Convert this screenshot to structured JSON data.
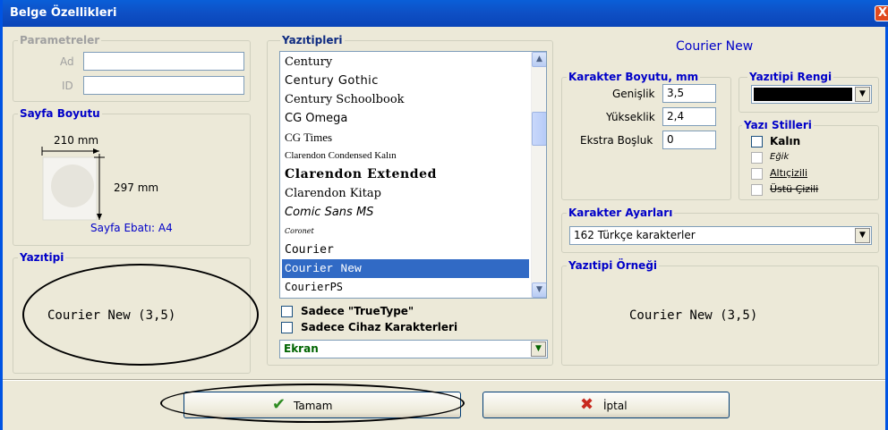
{
  "window": {
    "title": "Belge Özellikleri",
    "close_glyph": "X"
  },
  "parametreler": {
    "legend": "Parametreler",
    "ad_label": "Ad",
    "ad_value": "",
    "id_label": "ID",
    "id_value": ""
  },
  "sayfa_boyutu": {
    "legend": "Sayfa Boyutu",
    "width": "210 mm",
    "height": "297 mm",
    "ebat": "Sayfa Ebatı: A4"
  },
  "yazitipi_preview": {
    "legend": "Yazıtipi",
    "sample": "Courier New (3,5)"
  },
  "yazitipleri": {
    "legend": "Yazıtipleri",
    "items": [
      "Century",
      "Century Gothic",
      "Century Schoolbook",
      "CG Omega",
      "CG Times",
      "Clarendon Condensed Kalın",
      "Clarendon Extended",
      "Clarendon Kitap",
      "Comic Sans MS",
      "Coronet",
      "Courier",
      "Courier New",
      "CourierPS"
    ],
    "selected": "Courier New",
    "only_truetype": "Sadece \"TrueType\"",
    "only_device": "Sadece Cihaz Karakterleri",
    "target_value": "Ekran"
  },
  "font_name": "Courier New",
  "karakter_boyutu": {
    "legend": "Karakter Boyutu, mm",
    "genislik_label": "Genişlik",
    "genislik_value": "3,5",
    "yukseklik_label": "Yükseklik",
    "yukseklik_value": "2,4",
    "bosluk_label": "Ekstra Boşluk",
    "bosluk_value": "0"
  },
  "yazitipi_rengi": {
    "legend": "Yazıtipi Rengi",
    "color": "#000000"
  },
  "yazi_stilleri": {
    "legend": "Yazı Stilleri",
    "bold": "Kalın",
    "italic": "Eğik",
    "underline": "Altıçizili",
    "strike": "Üstü Çizili"
  },
  "karakter_ayarlari": {
    "legend": "Karakter Ayarları",
    "value": "162 Türkçe karakterler"
  },
  "ornek": {
    "legend": "Yazıtipi Örneği",
    "sample": "Courier New (3,5)"
  },
  "buttons": {
    "ok": "Tamam",
    "cancel": "İptal"
  },
  "colors": {
    "titlebar": "#0e4fc4",
    "selection": "#316ac5",
    "legend_blue": "#0000c8"
  }
}
